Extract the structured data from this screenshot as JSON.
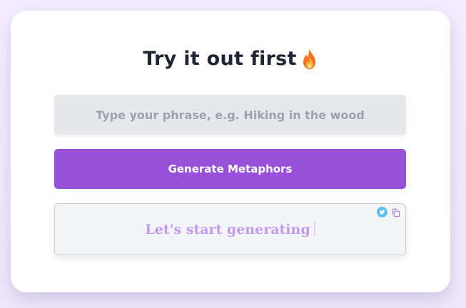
{
  "header": {
    "title": "Try it out first",
    "title_icon": "fire-icon"
  },
  "form": {
    "input_placeholder": "Type your phrase, e.g. Hiking in the wood",
    "input_value": "",
    "generate_label": "Generate Metaphors"
  },
  "output": {
    "text": "Let's start generating",
    "icons": [
      "twitter-icon",
      "copy-icon"
    ]
  },
  "colors": {
    "accent": "#984fd9",
    "output_text": "#c39bea",
    "input_bg": "#e5e7eb",
    "twitter": "#5bc0eb"
  }
}
